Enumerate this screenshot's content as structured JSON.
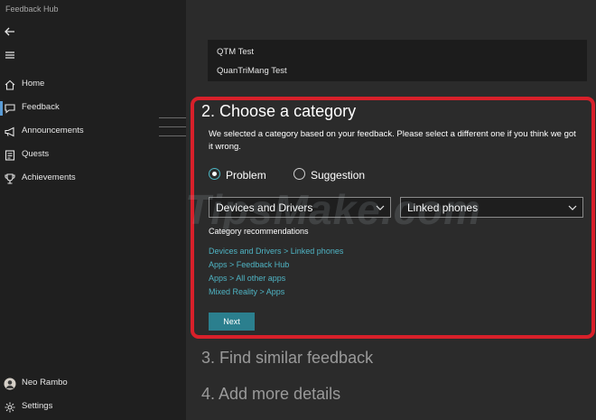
{
  "window": {
    "title": "Feedback Hub",
    "minimize_glyph": "—",
    "maximize_glyph": "☐",
    "close_glyph": "✕"
  },
  "sidebar": {
    "back_icon": "back-arrow-icon",
    "menu_icon": "hamburger-menu-icon",
    "items": [
      {
        "label": "Home",
        "icon": "home-icon",
        "active": false
      },
      {
        "label": "Feedback",
        "icon": "feedback-icon",
        "active": true
      },
      {
        "label": "Announcements",
        "icon": "megaphone-icon",
        "active": false
      },
      {
        "label": "Quests",
        "icon": "quests-icon",
        "active": false
      },
      {
        "label": "Achievements",
        "icon": "trophy-icon",
        "active": false
      }
    ],
    "user_name": "Neo Rambo",
    "settings_label": "Settings"
  },
  "main": {
    "previous_items": [
      "QTM Test",
      "QuanTriMang Test"
    ],
    "section2": {
      "title": "2. Choose a category",
      "description": "We selected a category based on your feedback. Please select a different one if you think we got it wrong.",
      "radio_options": [
        {
          "label": "Problem",
          "selected": true
        },
        {
          "label": "Suggestion",
          "selected": false
        }
      ],
      "category_value": "Devices and Drivers",
      "subcategory_value": "Linked phones",
      "recommendations_heading": "Category recommendations",
      "recommendations": [
        "Devices and Drivers > Linked phones",
        "Apps > Feedback Hub",
        "Apps > All other apps",
        "Mixed Reality > Apps"
      ],
      "next_label": "Next"
    },
    "section3_title": "3. Find similar feedback",
    "section4_title": "4. Add more details"
  },
  "watermark": "TipsMake.com",
  "colors": {
    "accent": "#4fb4c4",
    "highlight_border": "#d8202a",
    "button": "#2b7f8e",
    "active_indicator": "#5a9bd5"
  }
}
